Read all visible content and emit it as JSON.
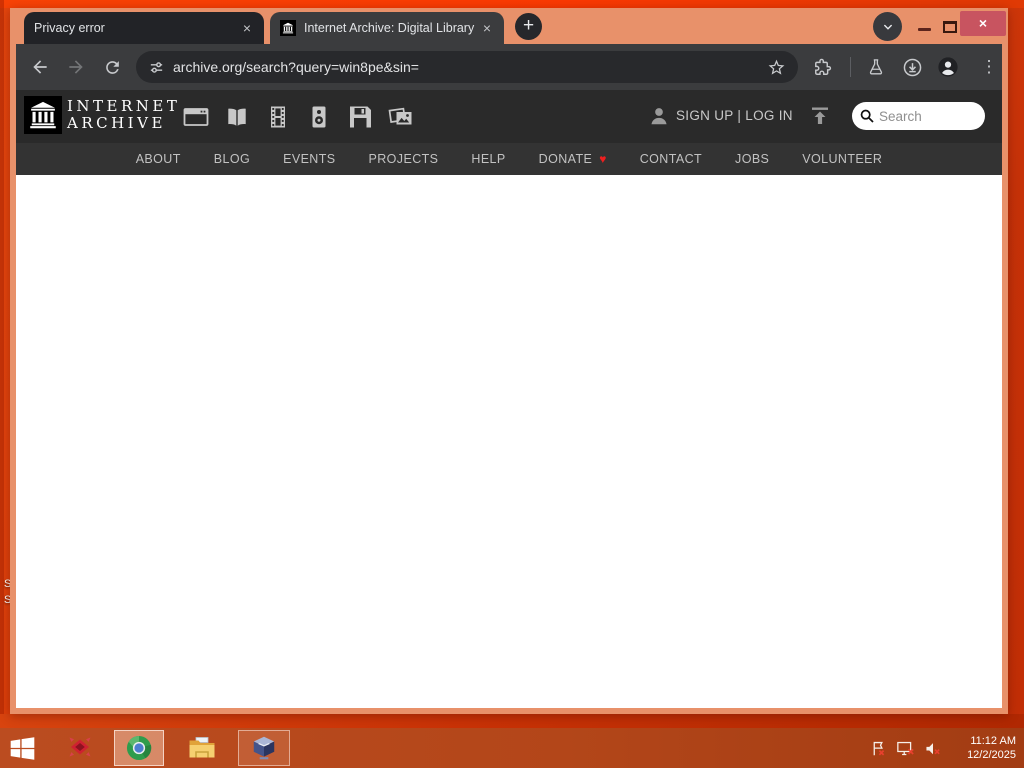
{
  "browser": {
    "tabs": [
      {
        "title": "Privacy error"
      },
      {
        "title": "Internet Archive: Digital Library"
      }
    ],
    "url": "archive.org/search?query=win8pe&sin="
  },
  "icons": {
    "tab_close": "×",
    "new_tab": "+",
    "window_close": "×",
    "kebab_menu": "⋮",
    "donate_heart": "♥"
  },
  "archive": {
    "wordmark_line1": "INTERNET",
    "wordmark_line2": "ARCHIVE",
    "media_types": [
      "web",
      "texts",
      "video",
      "audio",
      "software",
      "images"
    ],
    "signup_login": "SIGN UP | LOG IN",
    "search_placeholder": "Search",
    "nav_items": [
      {
        "label": "ABOUT"
      },
      {
        "label": "BLOG"
      },
      {
        "label": "EVENTS"
      },
      {
        "label": "PROJECTS"
      },
      {
        "label": "HELP"
      },
      {
        "label": "DONATE",
        "has_heart": true
      },
      {
        "label": "CONTACT"
      },
      {
        "label": "JOBS"
      },
      {
        "label": "VOLUNTEER"
      }
    ]
  },
  "taskbar": {
    "time": "11:12 AM",
    "date": "12/2/2025"
  },
  "desktop": {
    "icon_label_fragments": [
      "s",
      "S",
      "S"
    ]
  },
  "colors": {
    "desktop_orange": "#e2430e",
    "frame_salmon": "#e8916a",
    "close_red": "#c85460",
    "toolbar_gray": "#3b3c3e",
    "header_dark": "#2a2a2a",
    "nav_gray": "#333333",
    "heart_red": "#ef1f1f"
  }
}
